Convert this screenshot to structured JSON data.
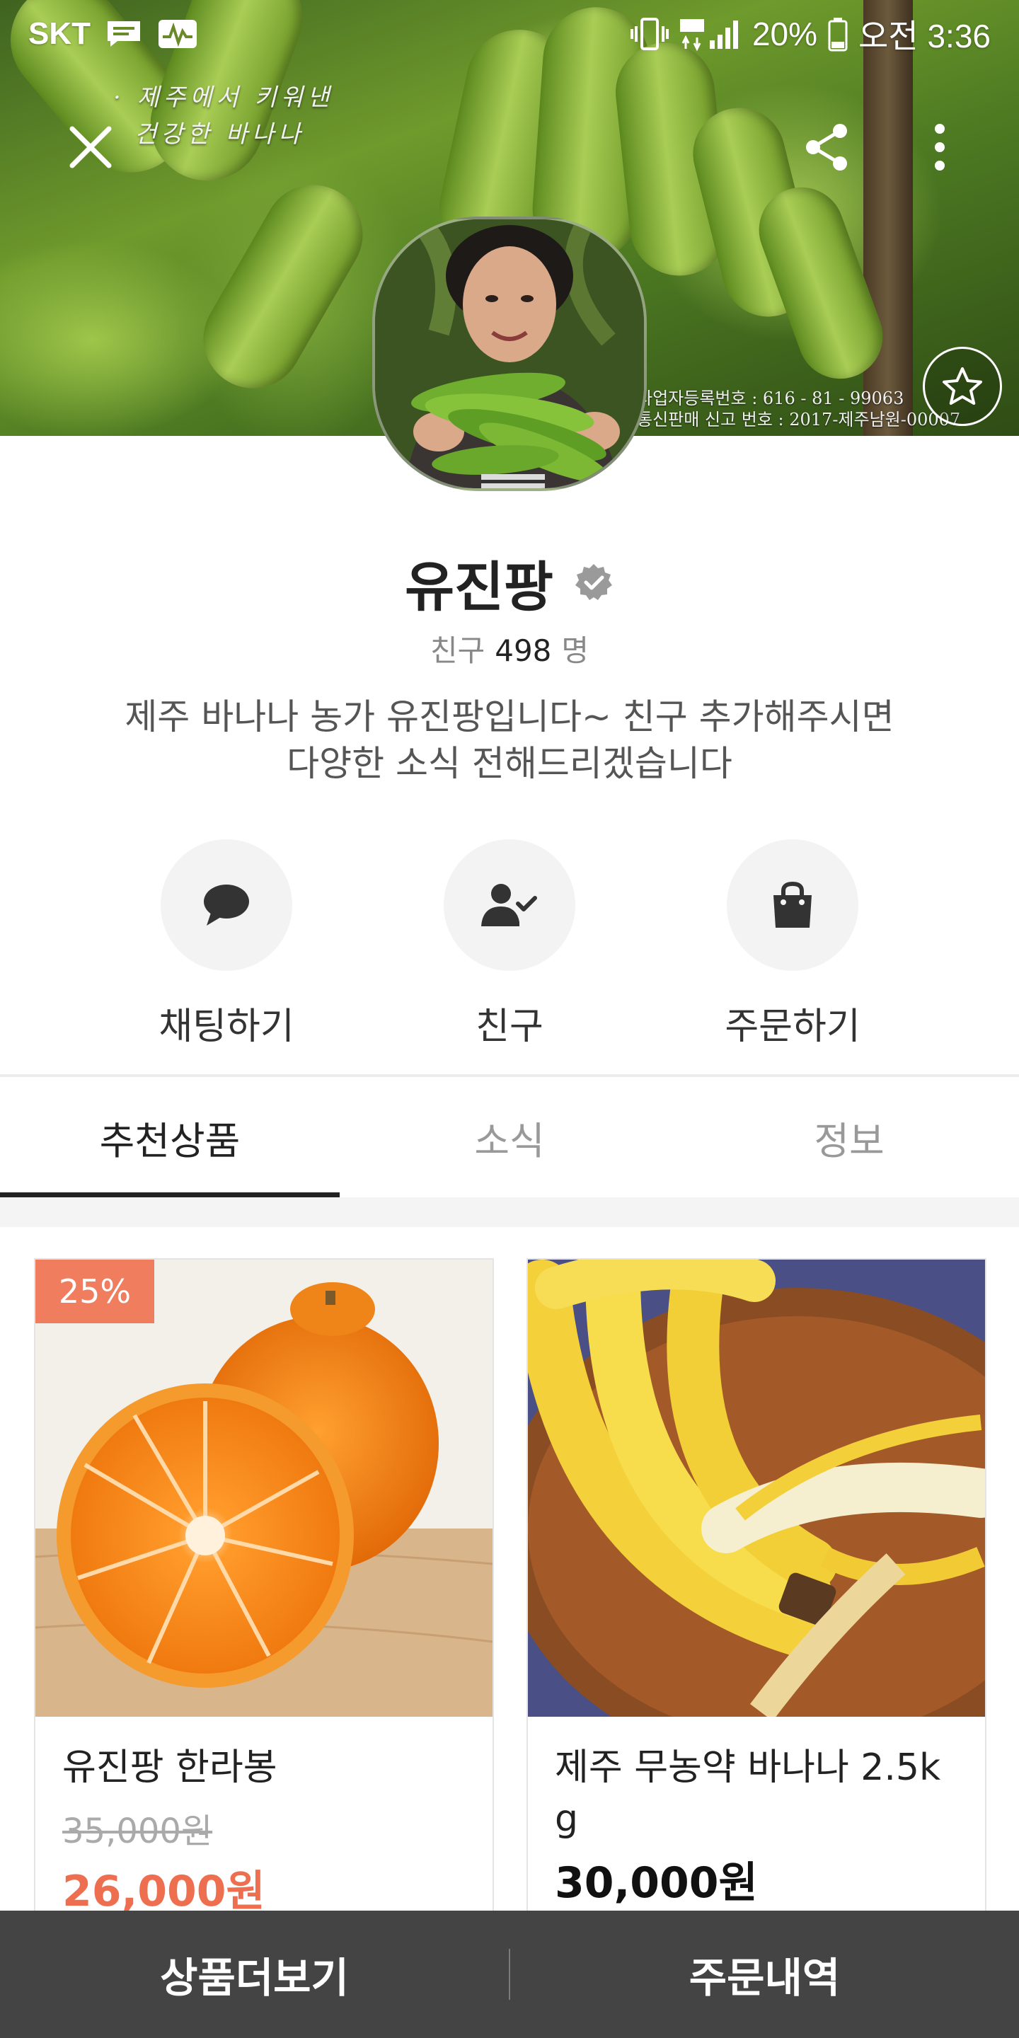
{
  "status_bar": {
    "carrier": "SKT",
    "battery": "20%",
    "time": "오전 3:36"
  },
  "cover": {
    "caption_line1": "· 제주에서 키워낸",
    "caption_line2": "건강한 바나나",
    "reg_line1": "사업자등록번호 : 616 - 81 - 99063",
    "reg_line2": "통신판매 신고 번호 : 2017-제주남원-00007"
  },
  "icons": {
    "close": "close-icon",
    "share": "share-icon",
    "more": "more-vertical-icon",
    "favorite": "star-icon",
    "verified": "verified-badge-icon",
    "chat": "chat-bubble-icon",
    "friend": "person-check-icon",
    "order": "shopping-bag-icon"
  },
  "profile": {
    "name": "유진팡",
    "friends_label": "친구",
    "friends_count": "498",
    "friends_unit": "명",
    "intro_line1": "제주 바나나 농가 유진팡입니다~ 친구 추가해주시면",
    "intro_line2": "다양한 소식 전해드리겠습니다"
  },
  "actions": [
    {
      "label": "채팅하기"
    },
    {
      "label": "친구"
    },
    {
      "label": "주문하기"
    }
  ],
  "tabs": [
    {
      "label": "추천상품",
      "active": true
    },
    {
      "label": "소식",
      "active": false
    },
    {
      "label": "정보",
      "active": false
    }
  ],
  "products": [
    {
      "badge": "25%",
      "title": "유진팡 한라봉",
      "original_price": "35,000원",
      "price": "26,000원",
      "price_color": "#ee6f4f"
    },
    {
      "title_line1": "제주 무농약 바나나 2.5k",
      "title_line2": "g",
      "price": "30,000원",
      "price_color": "#111111"
    }
  ],
  "bottom_bar": {
    "more_products": "상품더보기",
    "order_history": "주문내역"
  },
  "colors": {
    "accent_discount": "#f07d5e",
    "bottom_bar": "#444444"
  }
}
